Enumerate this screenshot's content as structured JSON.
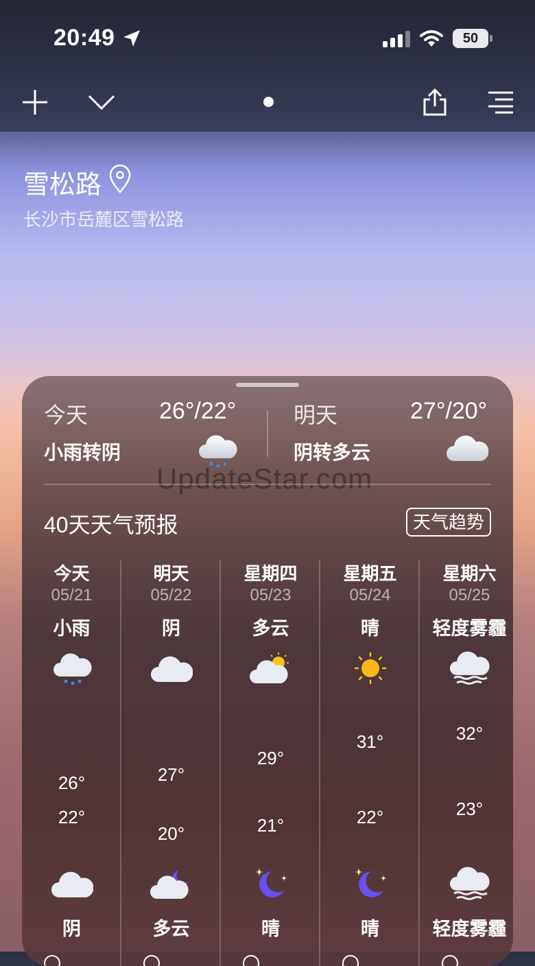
{
  "status_bar": {
    "time": "20:49",
    "battery": "50"
  },
  "location": {
    "name": "雪松路",
    "address": "长沙市岳麓区雪松路"
  },
  "summary": {
    "today": {
      "label": "今天",
      "temps": "26°/22°",
      "desc": "小雨转阴",
      "icon": "rain-cloud-icon"
    },
    "tomorrow": {
      "label": "明天",
      "temps": "27°/20°",
      "desc": "阴转多云",
      "icon": "cloud-icon"
    }
  },
  "watermark": "UpdateStar.com",
  "forecast": {
    "title": "40天天气预报",
    "trend_button": "天气趋势",
    "days": [
      {
        "day": "今天",
        "date": "05/21",
        "cond": "小雨",
        "icon": "rain-cloud-icon",
        "hi": "26°",
        "lo": "22°",
        "night_icon": "cloud-icon",
        "night_cond": "阴"
      },
      {
        "day": "明天",
        "date": "05/22",
        "cond": "阴",
        "icon": "cloud-icon",
        "hi": "27°",
        "lo": "20°",
        "night_icon": "cloud-moon-icon",
        "night_cond": "多云"
      },
      {
        "day": "星期四",
        "date": "05/23",
        "cond": "多云",
        "icon": "sun-cloud-icon",
        "hi": "29°",
        "lo": "21°",
        "night_icon": "moon-icon",
        "night_cond": "晴"
      },
      {
        "day": "星期五",
        "date": "05/24",
        "cond": "晴",
        "icon": "sun-icon",
        "hi": "31°",
        "lo": "22°",
        "night_icon": "moon-icon",
        "night_cond": "晴"
      },
      {
        "day": "星期六",
        "date": "05/25",
        "cond": "轻度雾霾",
        "icon": "haze-icon",
        "hi": "32°",
        "lo": "23°",
        "night_icon": "haze-icon",
        "night_cond": "轻度雾霾"
      }
    ]
  }
}
